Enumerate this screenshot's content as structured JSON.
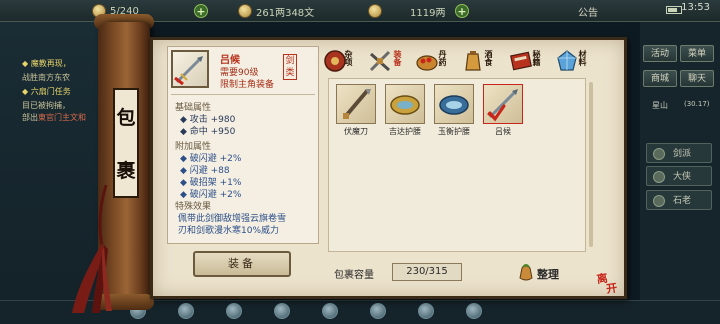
{
  "topbar": {
    "res1": "5/240",
    "res2": "261两348文",
    "res3": "1119两",
    "notice": "公告",
    "time": "13:53"
  },
  "quests": {
    "line1": "◆ 魔教再现，",
    "line2": "战胜南方东农",
    "line3": "◆ 六扇门任务",
    "line4": "目已被拘捕，",
    "line5_prefix": "部出",
    "line5_red": "東官门主文和"
  },
  "right_panel": {
    "btn_activity": "活动",
    "btn_mail": "菜单",
    "btn_shop": "商城",
    "btn_chat": "聊天",
    "location": "星山",
    "coords": "(30.17)",
    "list": [
      "剑派",
      "大侠",
      "石老"
    ]
  },
  "scroll_label": [
    "包",
    "裹"
  ],
  "item": {
    "name": "吕候",
    "level_req": "需要90级",
    "restriction": "限制主角装备",
    "type_badge": "剑类"
  },
  "base_attr": {
    "title": "基础属性",
    "stats": [
      "◆ 攻击 +980",
      "◆ 命中 +950"
    ]
  },
  "extra_attr": {
    "title": "附加属性",
    "stats": [
      "◆ 破闪避 +2%",
      "◆ 闪避 +88",
      "◆ 破招架 +1%",
      "◆ 破闪避 +2%"
    ]
  },
  "special": {
    "title": "特殊效果",
    "lines": [
      "佩带此剑御敌增强云旗卷雪",
      "刃和剑歌漫水寒10%威力"
    ]
  },
  "equip_button": "装备",
  "tabs": [
    {
      "label": "杂项",
      "icon": "misc-icon"
    },
    {
      "label": "装备",
      "icon": "equipment-icon"
    },
    {
      "label": "丹药",
      "icon": "pill-icon"
    },
    {
      "label": "酒食",
      "icon": "food-icon"
    },
    {
      "label": "秘籍",
      "icon": "manual-icon"
    },
    {
      "label": "材料",
      "icon": "material-icon"
    }
  ],
  "items": [
    {
      "name": "伏魔刀",
      "icon": "blade-icon"
    },
    {
      "name": "吉达护腰",
      "icon": "belt-icon"
    },
    {
      "name": "玉衡护腰",
      "icon": "jade-belt-icon"
    },
    {
      "name": "吕候",
      "icon": "sword-icon"
    }
  ],
  "capacity": {
    "label": "包裹容量",
    "value": "230/315"
  },
  "sort_button": "整理",
  "close_seal": [
    "离",
    "开"
  ],
  "colors": {
    "panel_bg": "#ece3cd",
    "item_name_red": "#b8321e",
    "stat_blue": "#2c4f8a"
  }
}
